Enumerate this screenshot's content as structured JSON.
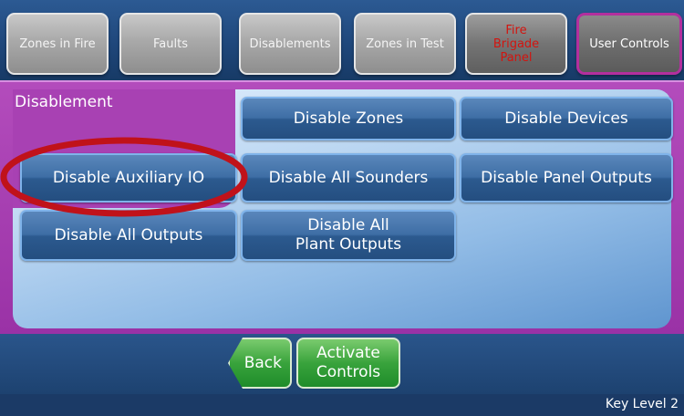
{
  "tabs": {
    "zones_in_fire": "Zones in Fire",
    "faults": "Faults",
    "disablements": "Disablements",
    "zones_in_test": "Zones in Test",
    "fire_brigade_panel": "Fire\nBrigade\nPanel",
    "user_controls": "User Controls"
  },
  "panel": {
    "title": "Disablement",
    "buttons": {
      "disable_zones": "Disable Zones",
      "disable_devices": "Disable Devices",
      "disable_auxiliary_io": "Disable Auxiliary IO",
      "disable_all_sounders": "Disable All Sounders",
      "disable_panel_outputs": "Disable Panel Outputs",
      "disable_all_outputs": "Disable All Outputs",
      "disable_all_plant_outputs": "Disable All\nPlant Outputs"
    }
  },
  "footer": {
    "back": "Back",
    "activate_controls": "Activate\nControls"
  },
  "status": {
    "key_level": "Key Level 2"
  },
  "colors": {
    "active_tab_border": "#b32f9e",
    "panel_purple": "#a841b3",
    "button_blue": "#3e6ea5",
    "green_button": "#39a33c",
    "fire_text_red": "#d3140f",
    "highlight_ring": "#c0121a"
  }
}
